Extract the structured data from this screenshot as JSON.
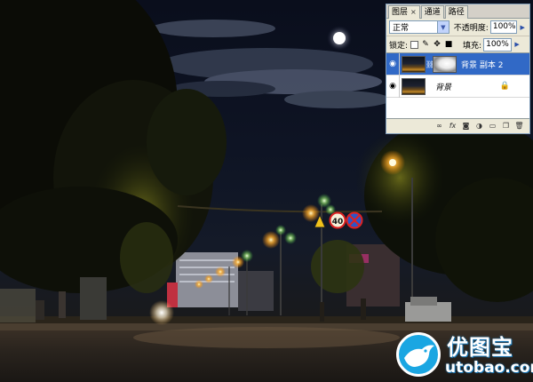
{
  "scene": {
    "sign_speed": "40"
  },
  "layers_panel": {
    "tabs": [
      {
        "label": "图层",
        "close": "×"
      },
      {
        "label": "通道"
      },
      {
        "label": "路径"
      }
    ],
    "blend_mode": "正常",
    "opacity_label": "不透明度:",
    "opacity_value": "100%",
    "lock_label": "锁定:",
    "fill_label": "填充:",
    "fill_value": "100%",
    "layers": [
      {
        "name": "背景 副本 2",
        "selected": true
      },
      {
        "name": "背景",
        "selected": false
      }
    ],
    "footer_icons": [
      "link-layers-icon",
      "fx-icon",
      "layer-mask-icon",
      "adjustment-layer-icon",
      "new-group-icon",
      "new-layer-icon",
      "trash-icon"
    ]
  },
  "watermark": {
    "chinese": "优图宝",
    "url": "utobao.com"
  },
  "colors": {
    "selection": "#3169c6",
    "panel": "#ece9d8",
    "logo_blue": "#1aa6e2"
  }
}
